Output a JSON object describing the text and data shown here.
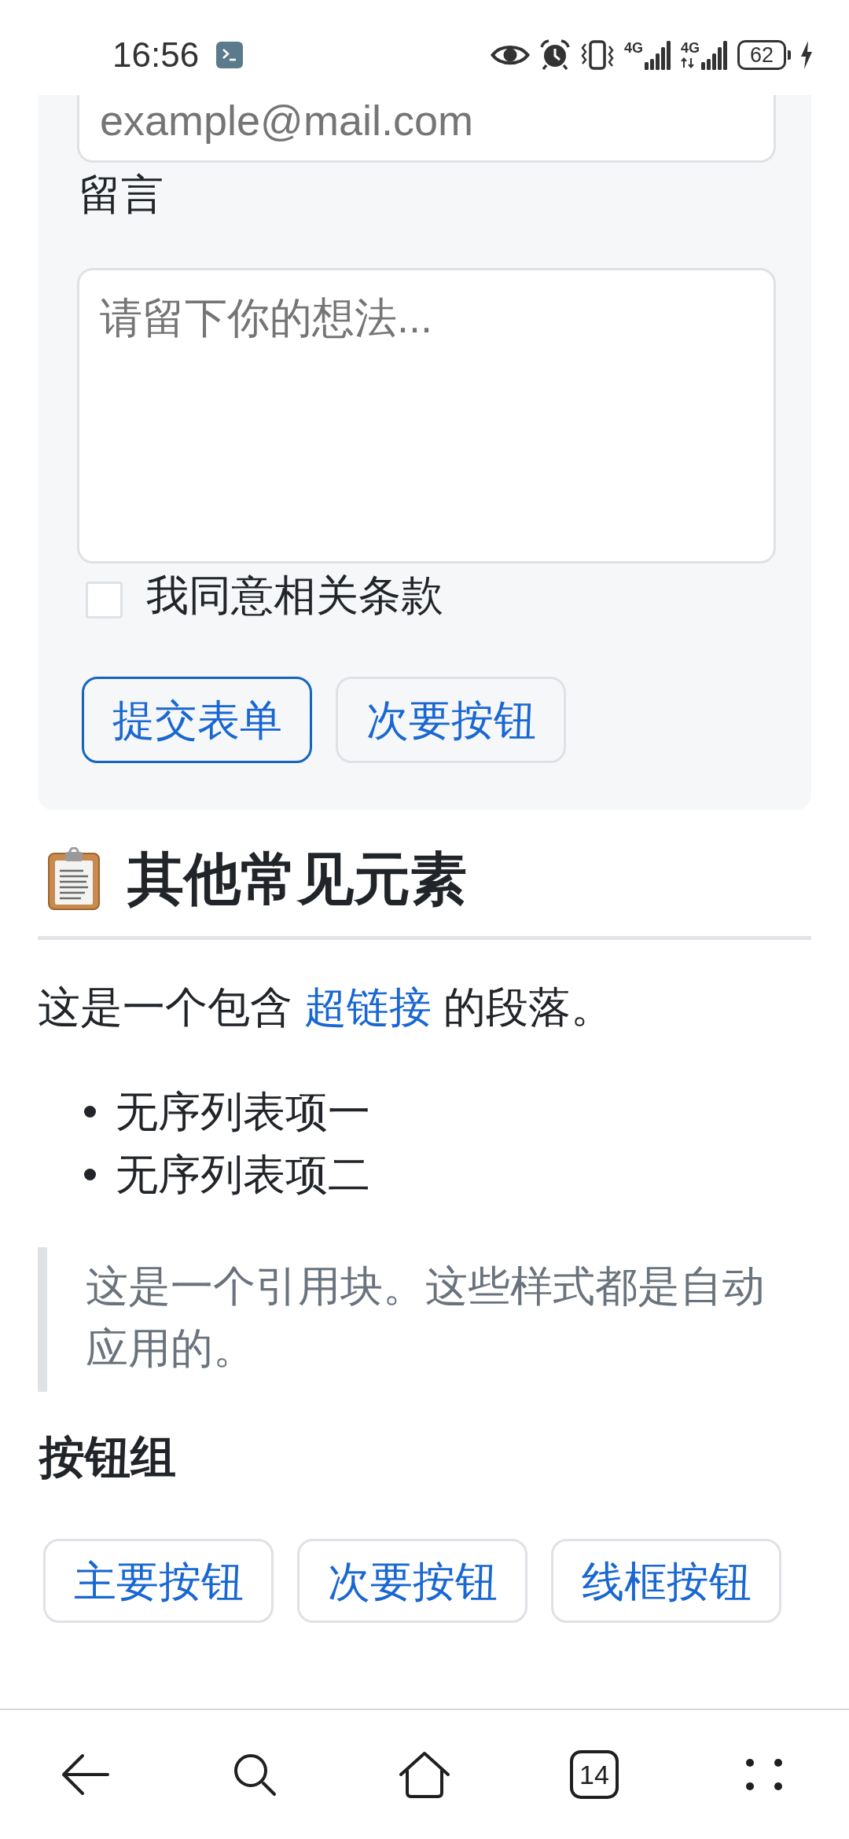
{
  "status_bar": {
    "time": "16:56",
    "networks": [
      {
        "label": "4G",
        "activity": false
      },
      {
        "label": "4G",
        "activity": true
      }
    ],
    "battery": "62"
  },
  "form": {
    "email": {
      "placeholder": "example@mail.com"
    },
    "message": {
      "label": "留言",
      "placeholder": "请留下你的想法..."
    },
    "agree": {
      "label": "我同意相关条款",
      "checked": false
    },
    "buttons": [
      {
        "label": "提交表单",
        "focused": true
      },
      {
        "label": "次要按钮",
        "focused": false
      }
    ]
  },
  "other_elements": {
    "title": "其他常见元素",
    "paragraph": {
      "before": "这是一个包含 ",
      "link": "超链接",
      "after": " 的段落。"
    },
    "list": [
      "无序列表项一",
      "无序列表项二"
    ],
    "quote": "这是一个引用块。这些样式都是自动应用的。"
  },
  "button_group": {
    "title": "按钮组",
    "buttons": [
      "主要按钮",
      "次要按钮",
      "线框按钮"
    ]
  },
  "browser_toolbar": {
    "tab_count": "14"
  }
}
